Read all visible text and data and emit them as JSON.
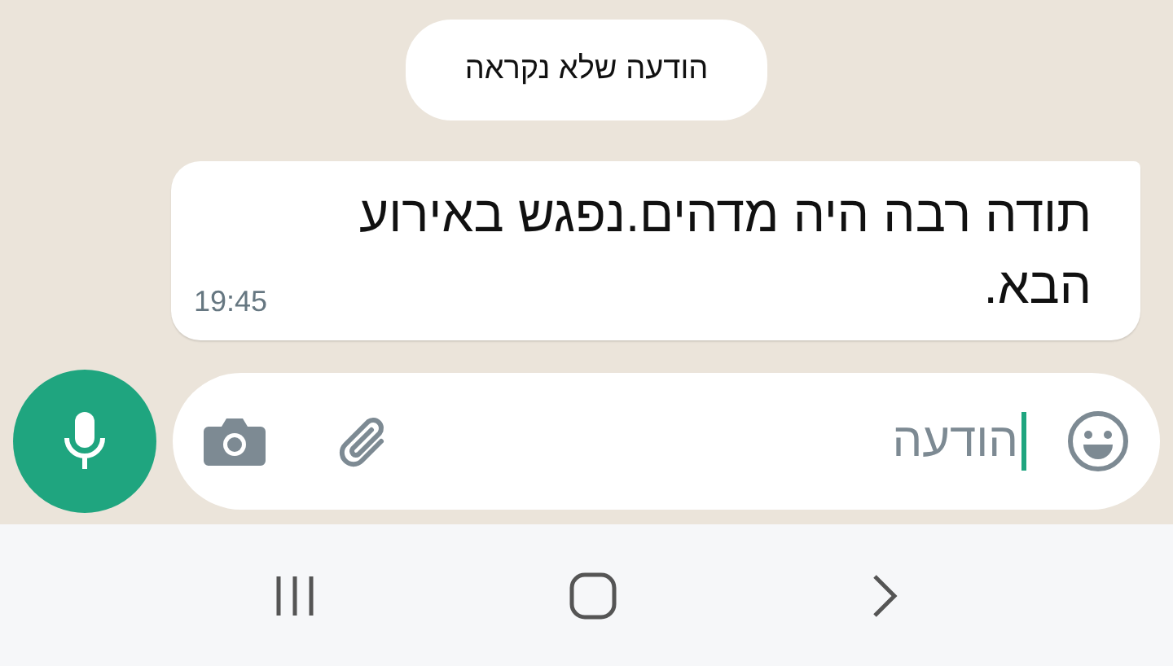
{
  "banner": "הודעה שלא נקראה",
  "messages": [
    {
      "text": "תודה רבה היה מדהים.נפגש באירוע הבא.",
      "time": "19:45",
      "outgoing": false
    }
  ],
  "composer": {
    "placeholder": "הודעה"
  }
}
